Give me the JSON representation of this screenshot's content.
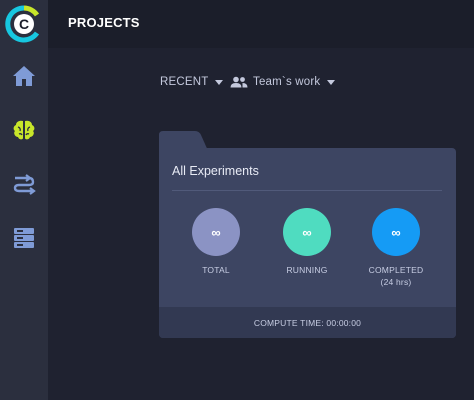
{
  "header": {
    "title": "PROJECTS"
  },
  "filters": {
    "recent_label": "RECENT",
    "team_label": "Team`s work"
  },
  "sidebar": {
    "items": [
      {
        "icon": "home-icon"
      },
      {
        "icon": "brain-icon",
        "active": true
      },
      {
        "icon": "flow-icon"
      },
      {
        "icon": "server-icon"
      }
    ]
  },
  "experiments": {
    "title": "All Experiments",
    "stats": [
      {
        "label": "TOTAL",
        "sublabel": "",
        "value": "∞",
        "color": "#8b93c4"
      },
      {
        "label": "RUNNING",
        "sublabel": "",
        "value": "∞",
        "color": "#4fdcc0"
      },
      {
        "label": "COMPLETED",
        "sublabel": "(24 hrs)",
        "value": "∞",
        "color": "#159bf5"
      }
    ],
    "compute_time_label": "COMPUTE TIME: 00:00:00"
  },
  "colors": {
    "sidebar_bg": "#2b2f3e",
    "main_bg": "#1f2230",
    "panel_bg": "#3d4562",
    "accent_green": "#c8e62a",
    "icon_blue": "#7f9bd6"
  }
}
